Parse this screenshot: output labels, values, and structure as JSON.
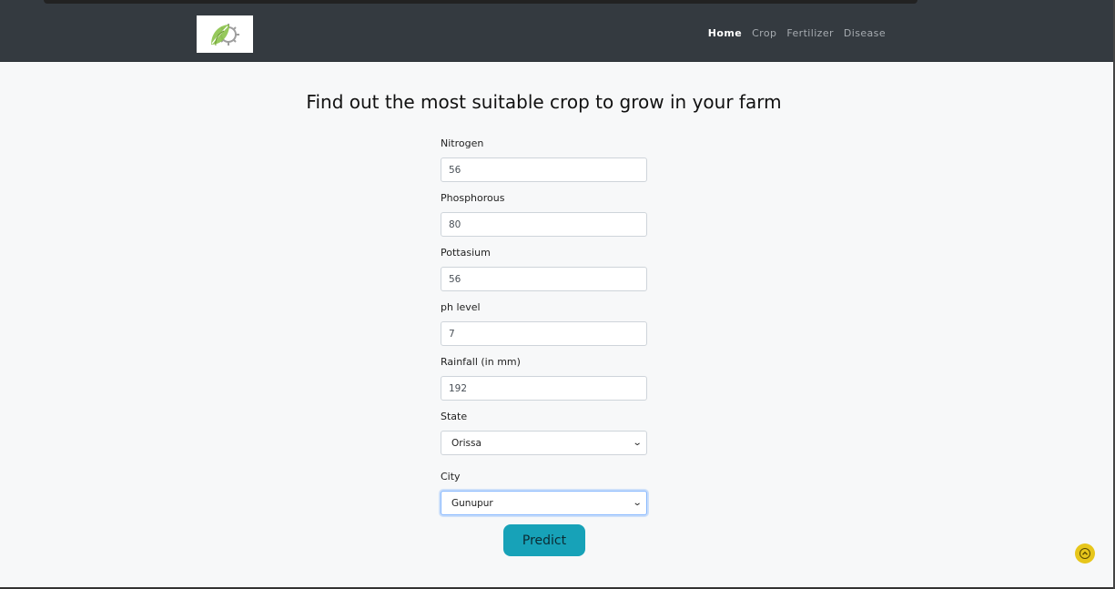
{
  "nav": {
    "logo_icon": "leaf-gear-logo",
    "links": [
      {
        "label": "Home",
        "active": true
      },
      {
        "label": "Crop",
        "active": false
      },
      {
        "label": "Fertilizer",
        "active": false
      },
      {
        "label": "Disease",
        "active": false
      }
    ]
  },
  "main": {
    "heading": "Find out the most suitable crop to grow in your farm"
  },
  "form": {
    "nitrogen": {
      "label": "Nitrogen",
      "value": "56"
    },
    "phosphorous": {
      "label": "Phosphorous",
      "value": "80"
    },
    "pottasium": {
      "label": "Pottasium",
      "value": "56"
    },
    "ph": {
      "label": "ph level",
      "value": "7"
    },
    "rainfall": {
      "label": "Rainfall (in mm)",
      "value": "192"
    },
    "state": {
      "label": "State",
      "selected": "Orissa"
    },
    "city": {
      "label": "City",
      "selected": "Gunupur"
    },
    "submit_label": "Predict"
  },
  "colors": {
    "navbar": "#343a40",
    "accent": "#17a2b8",
    "scroll_button": "#e7c61b",
    "logo_green": "#8bc34a"
  },
  "icons": {
    "chevron": "chevron-down-icon",
    "scroll_top": "chevron-up-icon"
  }
}
